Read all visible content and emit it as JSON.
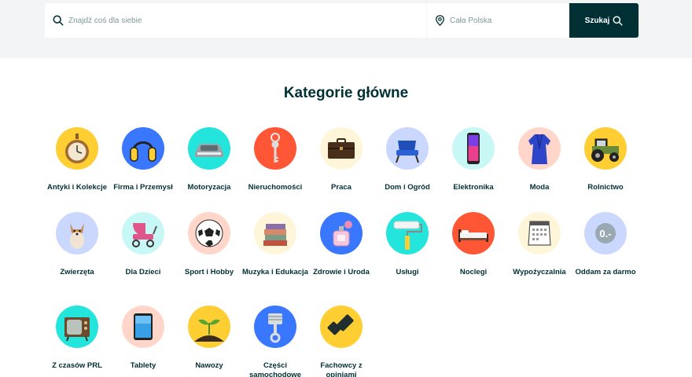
{
  "search": {
    "query_placeholder": "Znajdź coś dla siebie",
    "location_placeholder": "Cała Polska",
    "button_label": "Szukaj"
  },
  "section_title": "Kategorie główne",
  "categories": [
    {
      "label": "Antyki i Kolekcje",
      "icon": "pocket-watch-icon",
      "color": "#ffce32"
    },
    {
      "label": "Firma i Przemysł",
      "icon": "ear-protectors-icon",
      "color": "#3a77ff"
    },
    {
      "label": "Motoryzacja",
      "icon": "car-icon",
      "color": "#23e5db"
    },
    {
      "label": "Nieruchomości",
      "icon": "key-icon",
      "color": "#ff5636"
    },
    {
      "label": "Praca",
      "icon": "briefcase-icon",
      "color": "#fff6d9"
    },
    {
      "label": "Dom i Ogród",
      "icon": "armchair-icon",
      "color": "#cad7ff"
    },
    {
      "label": "Elektronika",
      "icon": "smartphone-icon",
      "color": "#c8f8f6"
    },
    {
      "label": "Moda",
      "icon": "robe-icon",
      "color": "#ffd6c9"
    },
    {
      "label": "Rolnictwo",
      "icon": "tractor-icon",
      "color": "#ffce32"
    },
    {
      "label": "Zwierzęta",
      "icon": "dog-icon",
      "color": "#cad7ff"
    },
    {
      "label": "Dla Dzieci",
      "icon": "stroller-icon",
      "color": "#c8f8f6"
    },
    {
      "label": "Sport i Hobby",
      "icon": "football-icon",
      "color": "#ffd6c9"
    },
    {
      "label": "Muzyka i Edukacja",
      "icon": "books-icon",
      "color": "#fff6d9"
    },
    {
      "label": "Zdrowie i Uroda",
      "icon": "perfume-icon",
      "color": "#3a77ff"
    },
    {
      "label": "Usługi",
      "icon": "paint-roller-icon",
      "color": "#23e5db"
    },
    {
      "label": "Noclegi",
      "icon": "bed-icon",
      "color": "#ff5636"
    },
    {
      "label": "Wypożyczalnia",
      "icon": "calendar-icon",
      "color": "#fff6d9"
    },
    {
      "label": "Oddam za darmo",
      "icon": "zero-price-icon",
      "color": "#cad7ff"
    },
    {
      "label": "Z czasów PRL",
      "icon": "retro-tv-icon",
      "color": "#23e5db"
    },
    {
      "label": "Tablety",
      "icon": "tablet-icon",
      "color": "#ffd6c9"
    },
    {
      "label": "Nawozy",
      "icon": "seedling-icon",
      "color": "#ffce32"
    },
    {
      "label": "Części samochodowe",
      "icon": "piston-icon",
      "color": "#3a77ff"
    },
    {
      "label": "Fachowcy z opiniami",
      "icon": "badge-check-icon",
      "color": "#ffce32"
    }
  ]
}
